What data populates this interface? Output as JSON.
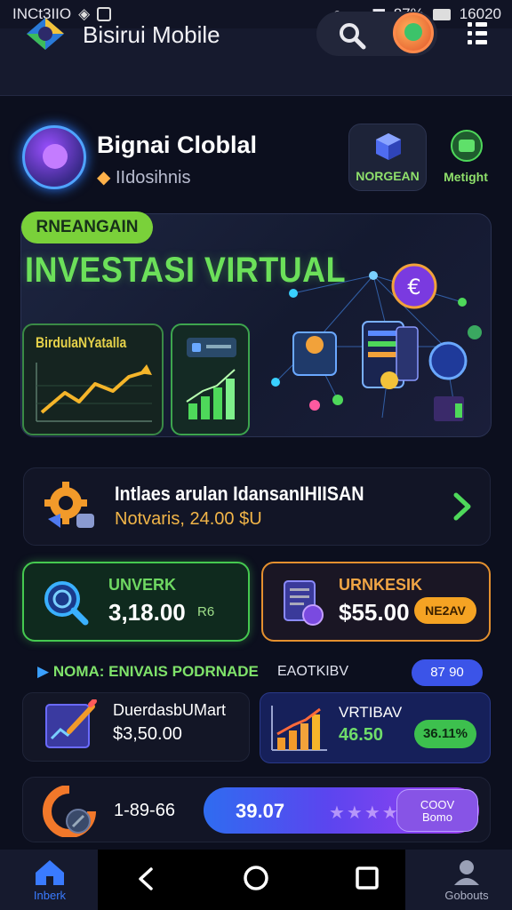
{
  "status_bar": {
    "left_text": "INCt3IIO",
    "right_text": "87%",
    "time": "16020"
  },
  "app_bar": {
    "title": "Bisirui Mobile"
  },
  "profile": {
    "name": "Bignai Cloblal",
    "subtitle": "IIdosihnis",
    "button_left_label": "NORGEAN",
    "button_right_label": "Metight"
  },
  "hero": {
    "badge": "RNEANGAIN",
    "title": "INVESTASI VIRTUAL",
    "mini_card_label": "BirdulaNYatalla"
  },
  "info": {
    "title": "Intlaes arulan IdansanIHIISAN",
    "subtitle": "Notvaris, 24.00 $U"
  },
  "cards": {
    "green": {
      "label": "UNVERK",
      "value": "3,18.00",
      "tag": "R6"
    },
    "orange": {
      "label": "URNKESIK",
      "value": "$55.00",
      "pill": "NE2AV"
    }
  },
  "section": {
    "left_label": "NOMA:  ENIVAIS PODRNADE",
    "right_label": "EAOTKIBV",
    "pill": "87 90"
  },
  "doc_card": {
    "title": "DuerdasbUMart",
    "value": "$3,50.00"
  },
  "blue_card": {
    "title": "VRTIBAV",
    "value": "46.50",
    "pill": "36.11%"
  },
  "strip": {
    "value": "1-89-66",
    "bar_value": "39.07",
    "bar_stars": "★★★★",
    "button_line1": "COOV",
    "button_line2": "Bomo"
  },
  "nav": {
    "home_label": "Inberk",
    "profile_label": "Gobouts"
  },
  "colors": {
    "accent_green": "#6ce05a",
    "accent_orange": "#f5a323",
    "accent_blue": "#3b54e8",
    "background": "#0c0f1e"
  }
}
